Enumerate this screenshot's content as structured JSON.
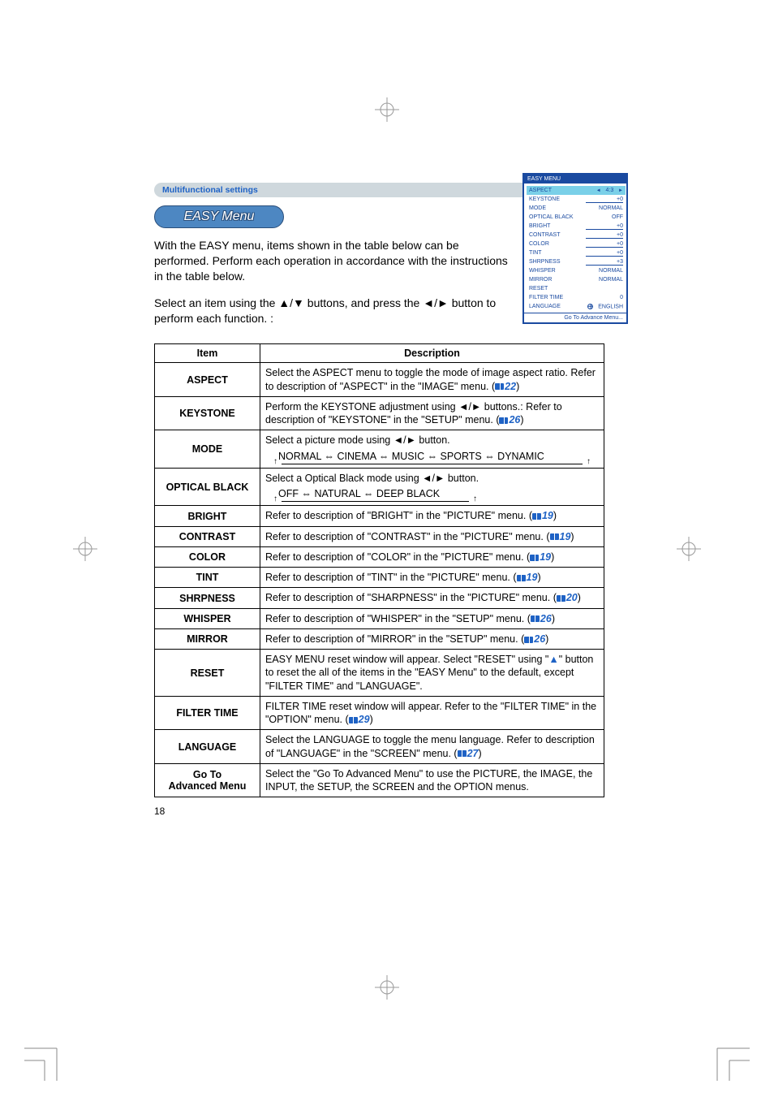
{
  "section_header": "Multifunctional settings",
  "title": "EASY Menu",
  "intro": {
    "p1": "With the EASY menu, items shown in the table below can be performed. Perform each operation in accordance with the instructions in the table below.",
    "p2": "Select an item using the ▲/▼ buttons, and press the ◄/► button to perform each function. :"
  },
  "osd": {
    "title": "EASY MENU",
    "rows": [
      {
        "label": "ASPECT",
        "value": "4:3",
        "highlight": true,
        "arrows": true
      },
      {
        "label": "KEYSTONE",
        "value": "+0",
        "bar": true
      },
      {
        "label": "MODE",
        "value": "NORMAL"
      },
      {
        "label": "OPTICAL BLACK",
        "value": "OFF"
      },
      {
        "label": "BRIGHT",
        "value": "+0",
        "bar": true
      },
      {
        "label": "CONTRAST",
        "value": "+0",
        "bar": true
      },
      {
        "label": "COLOR",
        "value": "+0",
        "bar": true
      },
      {
        "label": "TINT",
        "value": "+0",
        "bar": true
      },
      {
        "label": "SHRPNESS",
        "value": "+3",
        "bar": true
      },
      {
        "label": "WHISPER",
        "value": "NORMAL"
      },
      {
        "label": "MIRROR",
        "value": "NORMAL"
      },
      {
        "label": "RESET",
        "value": ""
      },
      {
        "label": "FILTER TIME",
        "value": "0"
      },
      {
        "label": "LANGUAGE",
        "value": "ENGLISH",
        "globe": true
      }
    ],
    "footer": "Go To Advance Menu..."
  },
  "table": {
    "headers": {
      "item": "Item",
      "desc": "Description"
    },
    "rows": [
      {
        "item": "ASPECT",
        "desc": "Select the ASPECT menu to toggle the mode of image aspect ratio. Refer to description of \"ASPECT\" in the \"IMAGE\" menu.",
        "ref": "22"
      },
      {
        "item": "KEYSTONE",
        "desc": "Perform the KEYSTONE adjustment using ◄/► buttons.: Refer to description of \"KEYSTONE\" in the \"SETUP\" menu.",
        "ref": "26"
      },
      {
        "item": "MODE",
        "desc": "Select a picture mode using ◄/► button.",
        "cycle": "NORMAL ⇔ CINEMA ⇔ MUSIC ⇔ SPORTS ⇔ DYNAMIC"
      },
      {
        "item": "OPTICAL BLACK",
        "desc": "Select a Optical Black mode using ◄/► button.",
        "cycle": "OFF ⇔ NATURAL ⇔ DEEP BLACK",
        "short": true
      },
      {
        "item": "BRIGHT",
        "desc": "Refer to description of \"BRIGHT\" in the \"PICTURE\" menu.",
        "ref": "19"
      },
      {
        "item": "CONTRAST",
        "desc": "Refer to description of \"CONTRAST\" in the \"PICTURE\" menu.",
        "ref": "19"
      },
      {
        "item": "COLOR",
        "desc": "Refer to description of \"COLOR\" in the \"PICTURE\" menu.",
        "ref": "19"
      },
      {
        "item": "TINT",
        "desc": "Refer to description of \"TINT\" in the \"PICTURE\" menu.",
        "ref": "19"
      },
      {
        "item": "SHRPNESS",
        "desc": "Refer to description of \"SHARPNESS\" in the \"PICTURE\" menu.",
        "ref": "20"
      },
      {
        "item": "WHISPER",
        "desc": "Refer to description of \"WHISPER\" in the \"SETUP\" menu.",
        "ref": "26"
      },
      {
        "item": "MIRROR",
        "desc": "Refer to description of \"MIRROR\" in the \"SETUP\" menu.",
        "ref": "26"
      },
      {
        "item": "RESET",
        "desc_pre": "EASY MENU reset window will appear. Select \"RESET\" using \"",
        "desc_mid": "▲",
        "desc_post": "\" button to reset the all of the items in the \"EASY Menu\" to the default, except \"FILTER TIME\" and \"LANGUAGE\"."
      },
      {
        "item": "FILTER TIME",
        "desc": "FILTER TIME reset window will appear. Refer to the \"FILTER TIME\" in the \"OPTION\" menu.",
        "ref": "29"
      },
      {
        "item": "LANGUAGE",
        "desc": "Select the LANGUAGE to toggle the menu language. Refer to description of \"LANGUAGE\" in the \"SCREEN\" menu.",
        "ref": "27"
      },
      {
        "item": "Go To Advanced Menu",
        "desc": "Select the \"Go To Advanced Menu\" to use the PICTURE, the IMAGE, the INPUT, the SETUP, the SCREEN and the OPTION menus."
      }
    ]
  },
  "page_number": "18"
}
